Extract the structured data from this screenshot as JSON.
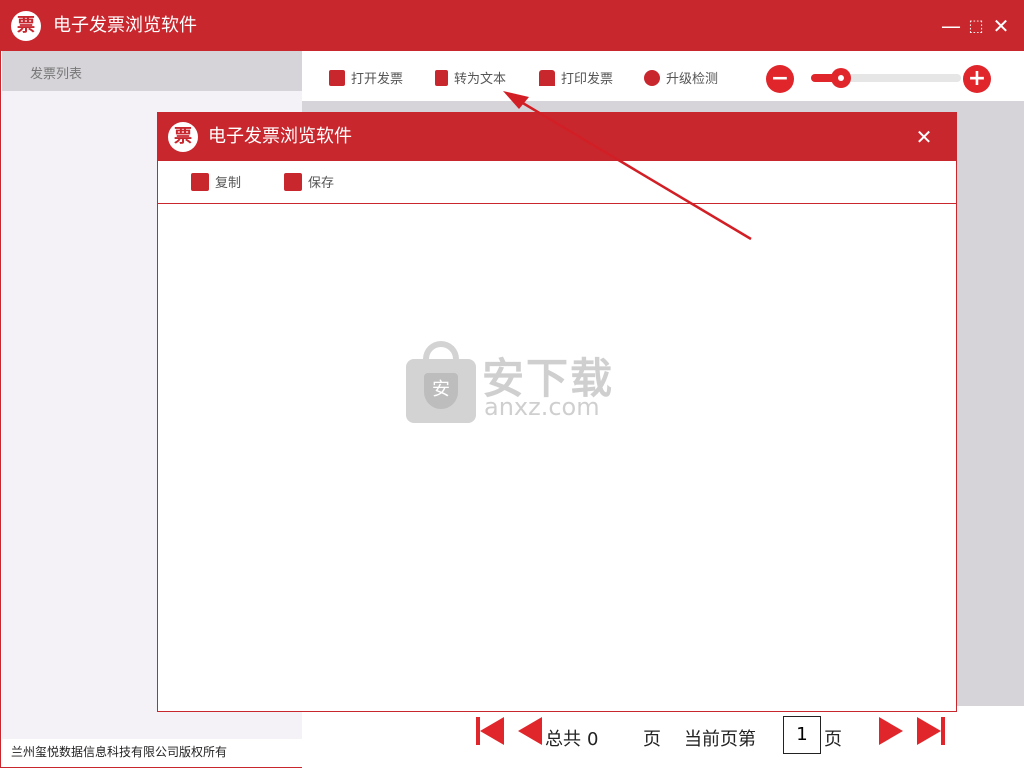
{
  "app": {
    "title": "电子发票浏览软件",
    "logo_char": "票",
    "window_controls": {
      "minimize": "—",
      "maximize": "⬚",
      "close": "✕"
    }
  },
  "sidebar": {
    "header": "发票列表"
  },
  "toolbar": {
    "open": "打开发票",
    "to_text": "转为文本",
    "print": "打印发票",
    "upgrade": "升级检测",
    "zoom_out": "−",
    "zoom_in": "+"
  },
  "pagination": {
    "total_prefix": "总共",
    "total_value": "0",
    "page_suffix": "页",
    "current_prefix": "当前页第",
    "current_value": "1",
    "current_suffix": "页"
  },
  "footer": {
    "copyright": "兰州玺悦数据信息科技有限公司版权所有"
  },
  "dialog": {
    "title": "电子发票浏览软件",
    "logo_char": "票",
    "close": "✕",
    "copy": "复制",
    "save": "保存"
  },
  "watermark": {
    "main": "安下载",
    "sub": "anxz.com",
    "badge": "安"
  },
  "colors": {
    "accent": "#c8272e",
    "bright_red": "#e0262b",
    "sidebar_bg": "#f4f2f7",
    "viewer_bg": "#d6d4d9"
  }
}
